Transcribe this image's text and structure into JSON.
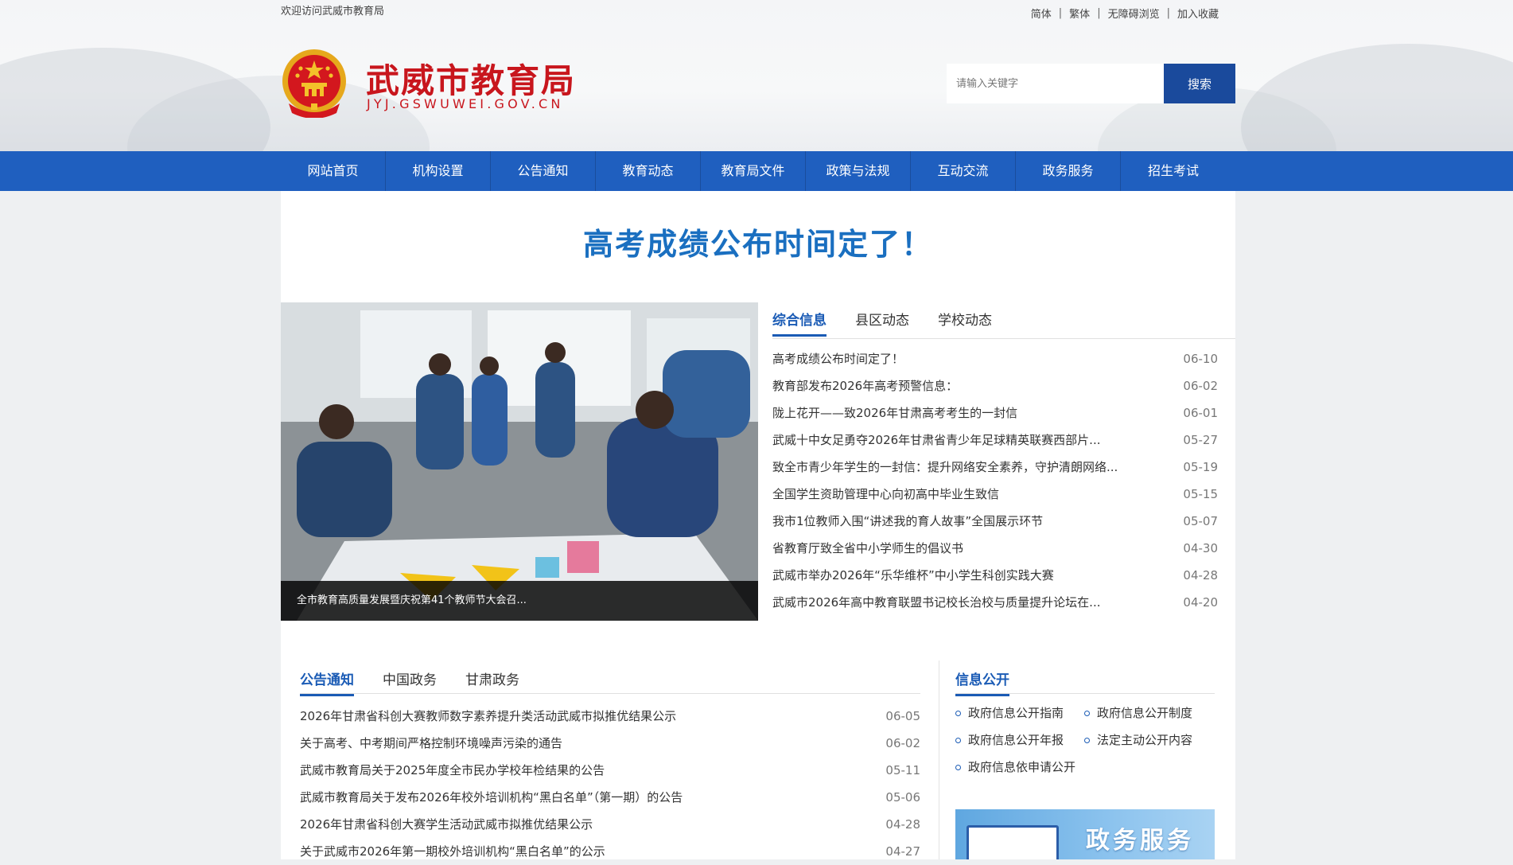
{
  "topbar": {
    "welcome": "欢迎访问武威市教育局",
    "links": [
      "简体",
      "繁体",
      "无障碍浏览",
      "加入收藏"
    ]
  },
  "site": {
    "name": "武威市教育局",
    "domain": "JYJ.GSWUWEI.GOV.CN"
  },
  "search": {
    "placeholder": "请输入关键字",
    "button": "搜索"
  },
  "nav": [
    "网站首页",
    "机构设置",
    "公告通知",
    "教育动态",
    "教育局文件",
    "政策与法规",
    "互动交流",
    "政务服务",
    "招生考试"
  ],
  "headline": "高考成绩公布时间定了！",
  "slide": {
    "caption": "全市教育高质量发展暨庆祝第41个教师节大会召..."
  },
  "news_tabs": [
    "综合信息",
    "县区动态",
    "学校动态"
  ],
  "news": [
    {
      "title": "高考成绩公布时间定了！",
      "date": "06-10"
    },
    {
      "title": "教育部发布2026年高考预警信息：",
      "date": "06-02"
    },
    {
      "title": "陇上花开——致2026年甘肃高考考生的一封信",
      "date": "06-01"
    },
    {
      "title": "武威十中女足勇夺2026年甘肃省青少年足球精英联赛西部片...",
      "date": "05-27"
    },
    {
      "title": "致全市青少年学生的一封信：提升网络安全素养，守护清朗网络...",
      "date": "05-19"
    },
    {
      "title": "全国学生资助管理中心向初高中毕业生致信",
      "date": "05-15"
    },
    {
      "title": "我市1位教师入围“讲述我的育人故事”全国展示环节",
      "date": "05-07"
    },
    {
      "title": "省教育厅致全省中小学师生的倡议书",
      "date": "04-30"
    },
    {
      "title": "武威市举办2026年“乐华维杯”中小学生科创实践大赛",
      "date": "04-28"
    },
    {
      "title": "武威市2026年高中教育联盟书记校长治校与质量提升论坛在...",
      "date": "04-20"
    }
  ],
  "notice_tabs": [
    "公告通知",
    "中国政务",
    "甘肃政务"
  ],
  "notices": [
    {
      "title": "2026年甘肃省科创大赛教师数字素养提升类活动武威市拟推优结果公示",
      "date": "06-05"
    },
    {
      "title": "关于高考、中考期间严格控制环境噪声污染的通告",
      "date": "06-02"
    },
    {
      "title": "武威市教育局关于2025年度全市民办学校年检结果的公告",
      "date": "05-11"
    },
    {
      "title": "武威市教育局关于发布2026年校外培训机构“黑白名单”（第一期）的公告",
      "date": "05-06"
    },
    {
      "title": "2026年甘肃省科创大赛学生活动武威市拟推优结果公示",
      "date": "04-28"
    },
    {
      "title": "关于武威市2026年第一期校外培训机构“黑白名单”的公示",
      "date": "04-27"
    }
  ],
  "info_open": {
    "title": "信息公开",
    "items": [
      "政府信息公开指南",
      "政府信息公开制度",
      "政府信息公开年报",
      "法定主动公开内容",
      "政府信息依申请公开"
    ]
  },
  "banner": {
    "text": "政务服务"
  }
}
